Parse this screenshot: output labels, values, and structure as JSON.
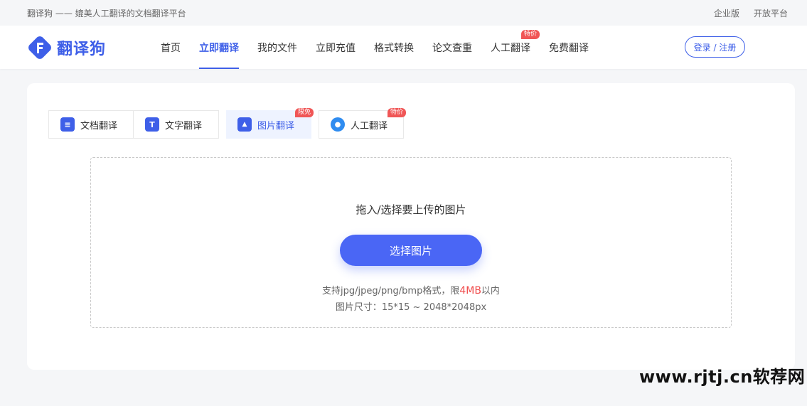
{
  "topbar": {
    "slogan": "翻译狗 —— 媲美人工翻译的文档翻译平台",
    "links": [
      "企业版",
      "开放平台"
    ]
  },
  "header": {
    "logo_text": "翻译狗",
    "nav": [
      {
        "label": "首页",
        "active": false,
        "badge": ""
      },
      {
        "label": "立即翻译",
        "active": true,
        "badge": ""
      },
      {
        "label": "我的文件",
        "active": false,
        "badge": ""
      },
      {
        "label": "立即充值",
        "active": false,
        "badge": ""
      },
      {
        "label": "格式转换",
        "active": false,
        "badge": ""
      },
      {
        "label": "论文查重",
        "active": false,
        "badge": ""
      },
      {
        "label": "人工翻译",
        "active": false,
        "badge": "特价"
      },
      {
        "label": "免费翻译",
        "active": false,
        "badge": ""
      }
    ],
    "login_label": "登录 / 注册"
  },
  "tabs": [
    {
      "label": "文档翻译",
      "icon": "document-icon",
      "icon_glyph": "≡",
      "badge": ""
    },
    {
      "label": "文字翻译",
      "icon": "text-icon",
      "icon_glyph": "T",
      "badge": ""
    },
    {
      "label": "图片翻译",
      "icon": "image-icon",
      "icon_glyph": "▲",
      "badge": "限免"
    },
    {
      "label": "人工翻译",
      "icon": "chat-icon",
      "icon_glyph": "●",
      "badge": "特价"
    }
  ],
  "upload": {
    "title": "拖入/选择要上传的图片",
    "button_label": "选择图片",
    "hint_prefix": "支持jpg/jpeg/png/bmp格式，限",
    "hint_limit": "4MB",
    "hint_suffix": "以内",
    "size_hint": "图片尺寸：15*15 ~ 2048*2048px"
  },
  "watermark": "www.rjtj.cn软荐网",
  "colors": {
    "accent": "#3e5fe8",
    "button": "#4a66f5",
    "badge": "#f05656"
  }
}
